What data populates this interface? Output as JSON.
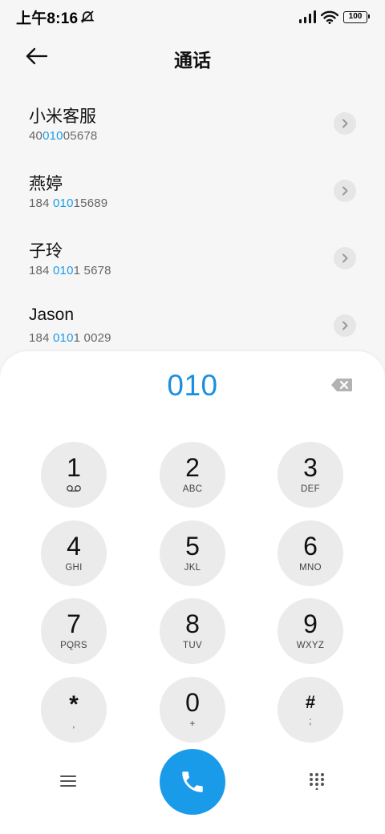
{
  "status_bar": {
    "time": "上午8:16",
    "battery": "100",
    "icons": [
      "alarm-muted-icon",
      "signal-icon",
      "wifi-icon",
      "battery-icon"
    ]
  },
  "header": {
    "title": "通话",
    "back_icon": "arrow-left-icon"
  },
  "contacts": [
    {
      "name": "小米客服",
      "number_pre": "40",
      "number_match": "010",
      "number_post": "05678"
    },
    {
      "name": "燕婷",
      "number_pre": "184 ",
      "number_match": "010",
      "number_post": "15689"
    },
    {
      "name": "子玲",
      "number_pre": "184 ",
      "number_match": "010",
      "number_post": "1 5678"
    },
    {
      "name": "Jason",
      "number_pre": "184 ",
      "number_match": "010",
      "number_post": "1 0029"
    }
  ],
  "dialer": {
    "input_value": "010",
    "keys": [
      {
        "digit": "1",
        "letters": "",
        "sub_icon": "voicemail-icon"
      },
      {
        "digit": "2",
        "letters": "ABC"
      },
      {
        "digit": "3",
        "letters": "DEF"
      },
      {
        "digit": "4",
        "letters": "GHI"
      },
      {
        "digit": "5",
        "letters": "JKL"
      },
      {
        "digit": "6",
        "letters": "MNO"
      },
      {
        "digit": "7",
        "letters": "PQRS"
      },
      {
        "digit": "8",
        "letters": "TUV"
      },
      {
        "digit": "9",
        "letters": "WXYZ"
      },
      {
        "digit": "*",
        "letters": ","
      },
      {
        "digit": "0",
        "letters": "+"
      },
      {
        "digit": "#",
        "letters": ";"
      }
    ]
  },
  "bottom_bar": {
    "left_icon": "menu-icon",
    "center_icon": "phone-icon",
    "right_icon": "keypad-icon"
  },
  "colors": {
    "accent": "#1a9bea",
    "key_background": "#ebebeb",
    "page_background": "#f6f6f6"
  }
}
